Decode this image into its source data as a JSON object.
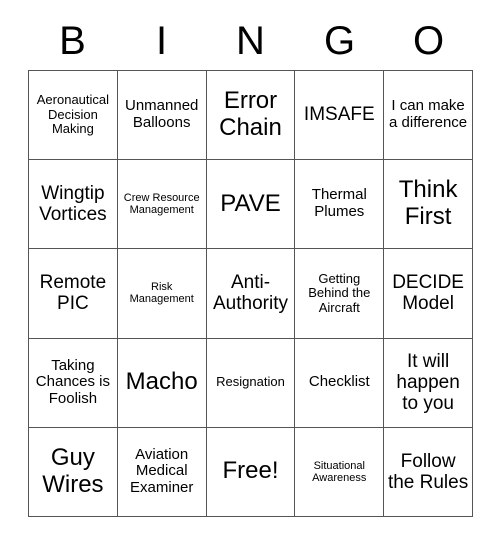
{
  "card": {
    "title_letters": [
      "B",
      "I",
      "N",
      "G",
      "O"
    ],
    "cells": [
      {
        "text": "Aeronautical Decision Making",
        "size": "fs-s"
      },
      {
        "text": "Unmanned Balloons",
        "size": "fs-m"
      },
      {
        "text": "Error Chain",
        "size": "fs-xl"
      },
      {
        "text": "IMSAFE",
        "size": "fs-l"
      },
      {
        "text": "I can make a difference",
        "size": "fs-m"
      },
      {
        "text": "Wingtip Vortices",
        "size": "fs-l"
      },
      {
        "text": "Crew Resource Management",
        "size": "fs-xs"
      },
      {
        "text": "PAVE",
        "size": "fs-xl"
      },
      {
        "text": "Thermal Plumes",
        "size": "fs-m"
      },
      {
        "text": "Think First",
        "size": "fs-xl"
      },
      {
        "text": "Remote PIC",
        "size": "fs-l"
      },
      {
        "text": "Risk Management",
        "size": "fs-xs"
      },
      {
        "text": "Anti-Authority",
        "size": "fs-l"
      },
      {
        "text": "Getting Behind the Aircraft",
        "size": "fs-s"
      },
      {
        "text": "DECIDE Model",
        "size": "fs-l"
      },
      {
        "text": "Taking Chances is Foolish",
        "size": "fs-m"
      },
      {
        "text": "Macho",
        "size": "fs-xl"
      },
      {
        "text": "Resignation",
        "size": "fs-s"
      },
      {
        "text": "Checklist",
        "size": "fs-m"
      },
      {
        "text": "It will happen to you",
        "size": "fs-l"
      },
      {
        "text": "Guy Wires",
        "size": "fs-xl"
      },
      {
        "text": "Aviation Medical Examiner",
        "size": "fs-m"
      },
      {
        "text": "Free!",
        "size": "fs-xl"
      },
      {
        "text": "Situational Awareness",
        "size": "fs-xs"
      },
      {
        "text": "Follow the Rules",
        "size": "fs-l"
      }
    ]
  }
}
